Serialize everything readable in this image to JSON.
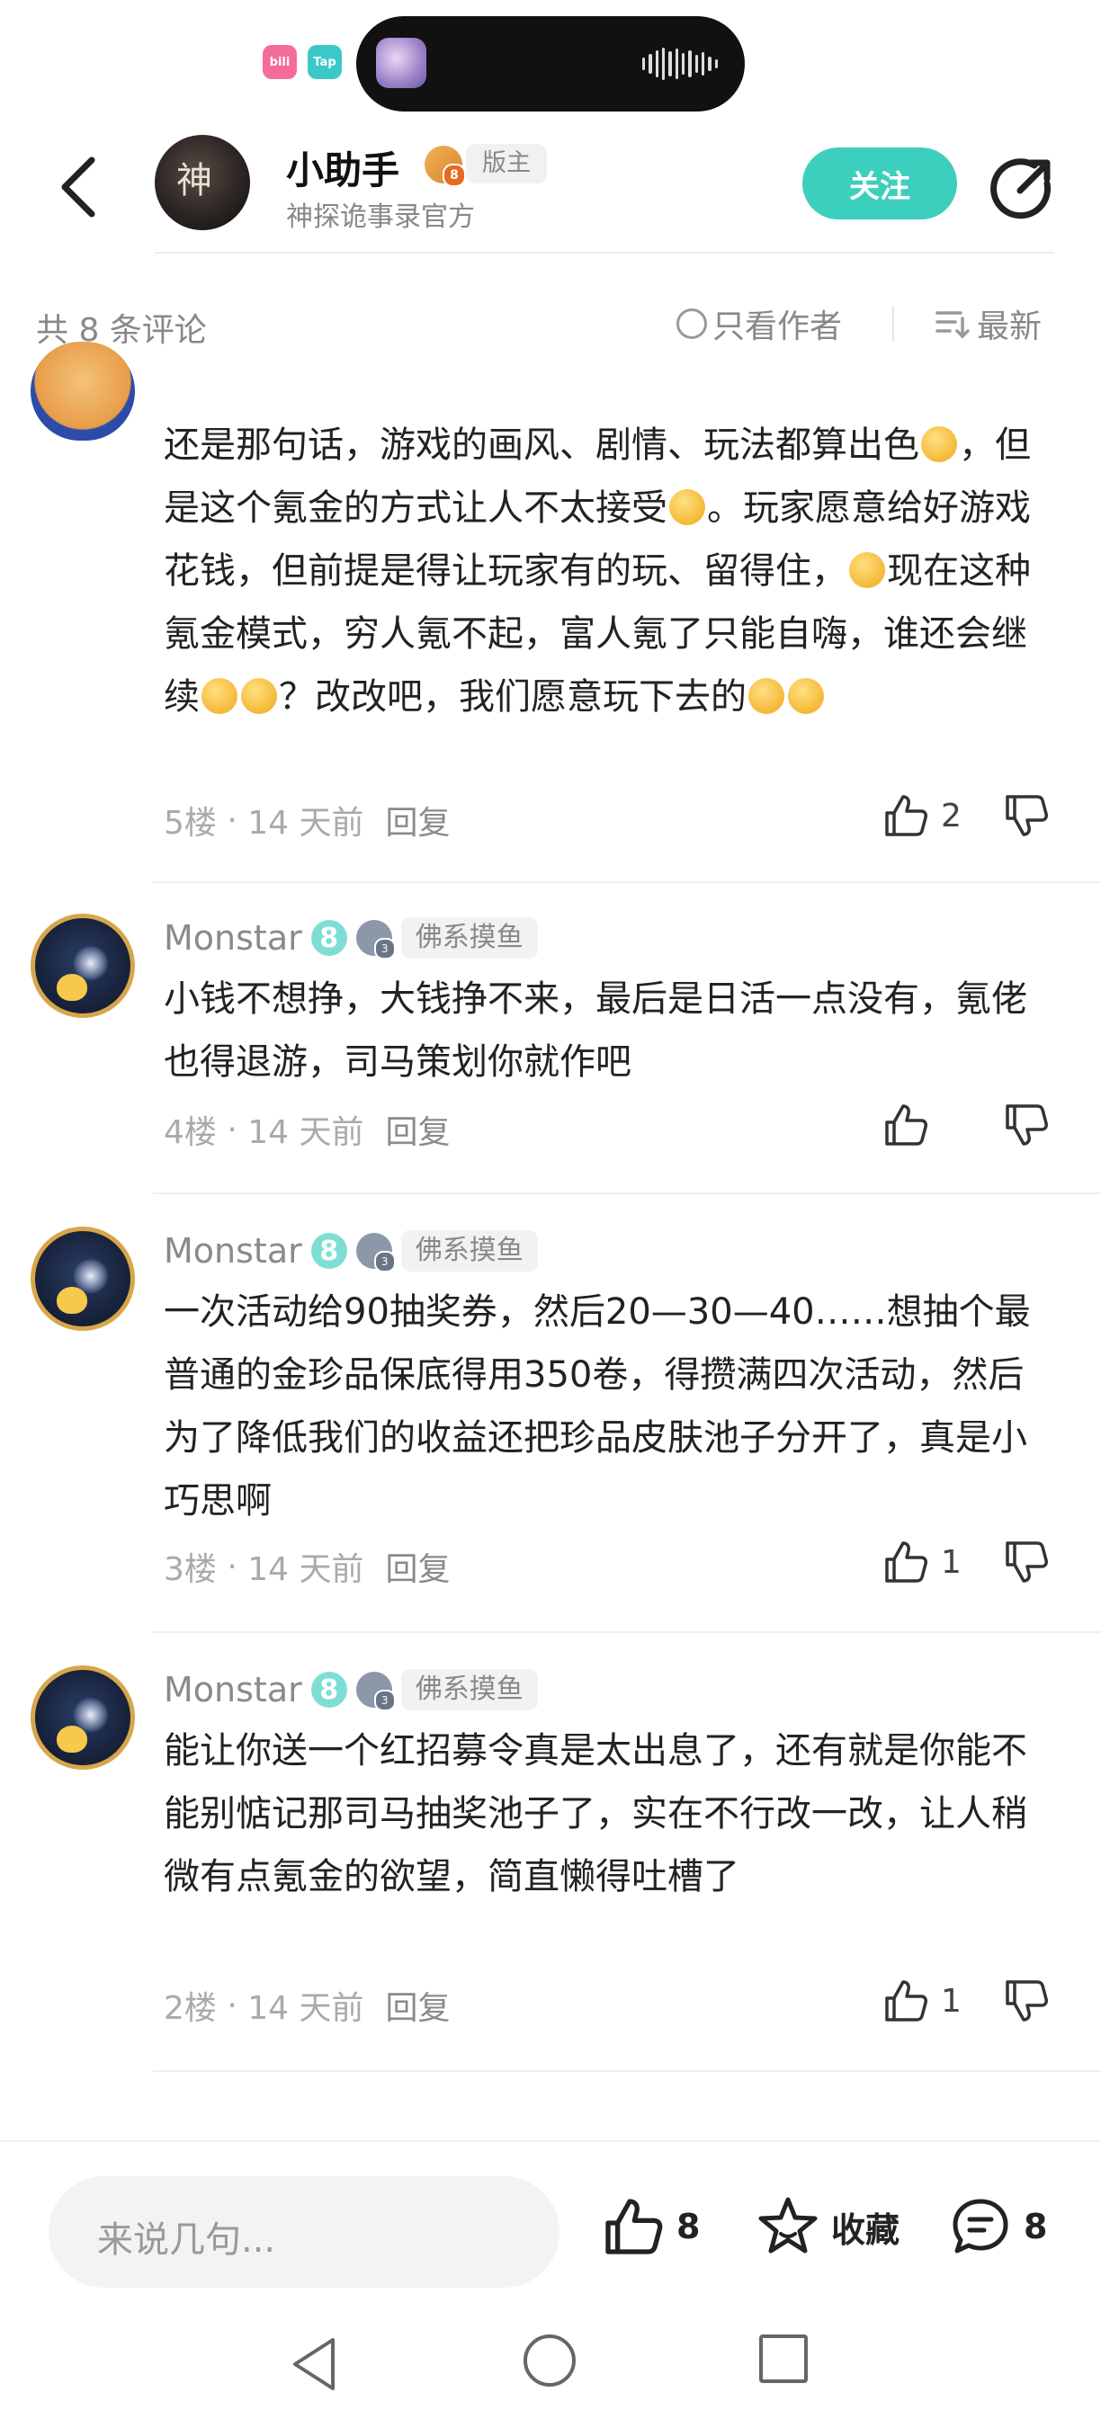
{
  "status_bar": {
    "badge_left": "bili",
    "badge_right": "Tap"
  },
  "header": {
    "author_name": "小助手",
    "role": "版主",
    "subtitle": "神探诡事录官方",
    "follow_label": "关注"
  },
  "filter": {
    "count_text": "共 8 条评论",
    "author_only": "只看作者",
    "sort": "最新"
  },
  "comments": [
    {
      "user": "",
      "text_parts": [
        "还是那句话，游戏的画风、剧情、玩法都算出色",
        "，但是这个氪金的方式让人不太接受",
        "。玩家愿意给好游戏花钱，但前提是得让玩家有的玩、留得住，",
        "现在这种氪金模式，穷人氪不起，富人氪了只能自嗨，谁还会继续",
        "？改改吧，我们愿意玩下去的"
      ],
      "floor": "5楼",
      "time": "14 天前",
      "reply": "回复",
      "likes": "2"
    },
    {
      "user": "Monstar",
      "level": "8",
      "tag": "佛系摸鱼",
      "text": "小钱不想挣，大钱挣不来，最后是日活一点没有，氪佬也得退游，司马策划你就作吧",
      "floor": "4楼",
      "time": "14 天前",
      "reply": "回复",
      "likes": ""
    },
    {
      "user": "Monstar",
      "level": "8",
      "tag": "佛系摸鱼",
      "text": "一次活动给90抽奖券，然后20—30—40……想抽个最普通的金珍品保底得用350卷，得攒满四次活动，然后为了降低我们的收益还把珍品皮肤池子分开了，真是小巧思啊",
      "floor": "3楼",
      "time": "14 天前",
      "reply": "回复",
      "likes": "1"
    },
    {
      "user": "Monstar",
      "level": "8",
      "tag": "佛系摸鱼",
      "text": "能让你送一个红招募令真是太出息了，还有就是你能不能别惦记那司马抽奖池子了，实在不行改一改，让人稍微有点氪金的欲望，简直懒得吐槽了",
      "floor": "2楼",
      "time": "14 天前",
      "reply": "回复",
      "likes": "1"
    }
  ],
  "bottom_bar": {
    "input_placeholder": "来说几句...",
    "like_count": "8",
    "favorite_label": "收藏",
    "comment_count": "8"
  },
  "colors": {
    "accent": "#3dcfbd",
    "text": "#222222",
    "muted": "#888888"
  },
  "icons": [
    "back-icon",
    "share-icon",
    "circle-icon",
    "sort-icon",
    "thumbs-up-icon",
    "thumbs-down-icon",
    "star-icon",
    "comment-icon"
  ]
}
